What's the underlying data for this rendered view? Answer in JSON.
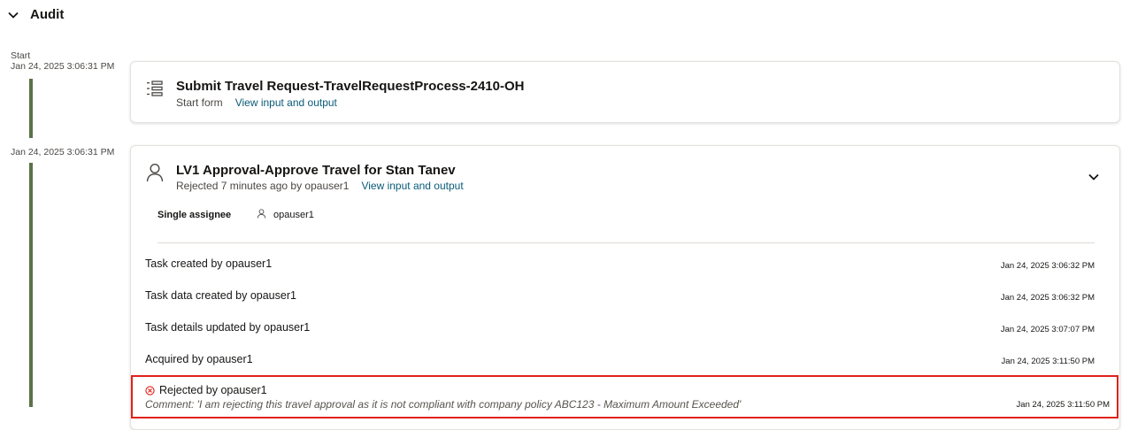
{
  "section": {
    "title": "Audit"
  },
  "timeline": [
    {
      "label": "Start",
      "date": "Jan 24, 2025 3:06:31 PM"
    },
    {
      "label": "",
      "date": "Jan 24, 2025 3:06:31 PM"
    }
  ],
  "start_card": {
    "title": "Submit Travel Request-TravelRequestProcess-2410-OH",
    "subtitle": "Start form",
    "link": "View input and output",
    "icon": "list-form-icon"
  },
  "task_card": {
    "title": "LV1 Approval-Approve Travel for Stan Tanev",
    "subtitle": "Rejected 7 minutes ago by opauser1",
    "link": "View input and output",
    "icon": "user-icon",
    "assignee_label": "Single assignee",
    "assignee": "opauser1",
    "events": [
      {
        "text": "Task created by opauser1",
        "date": "Jan 24, 2025 3:06:32 PM"
      },
      {
        "text": "Task data created by opauser1",
        "date": "Jan 24, 2025 3:06:32 PM"
      },
      {
        "text": "Task details updated by opauser1",
        "date": "Jan 24, 2025 3:07:07 PM"
      },
      {
        "text": "Acquired by opauser1",
        "date": "Jan 24, 2025 3:11:50 PM"
      },
      {
        "text": "Rejected by opauser1",
        "date": "Jan 24, 2025 3:11:50 PM",
        "comment": "Comment: 'I am rejecting this travel approval as it is not compliant with company policy ABC123 - Maximum Amount Exceeded'"
      }
    ]
  },
  "colors": {
    "timeline_bar": "#5b7247",
    "link": "#0a5a78",
    "rejected": "#e0221b"
  }
}
